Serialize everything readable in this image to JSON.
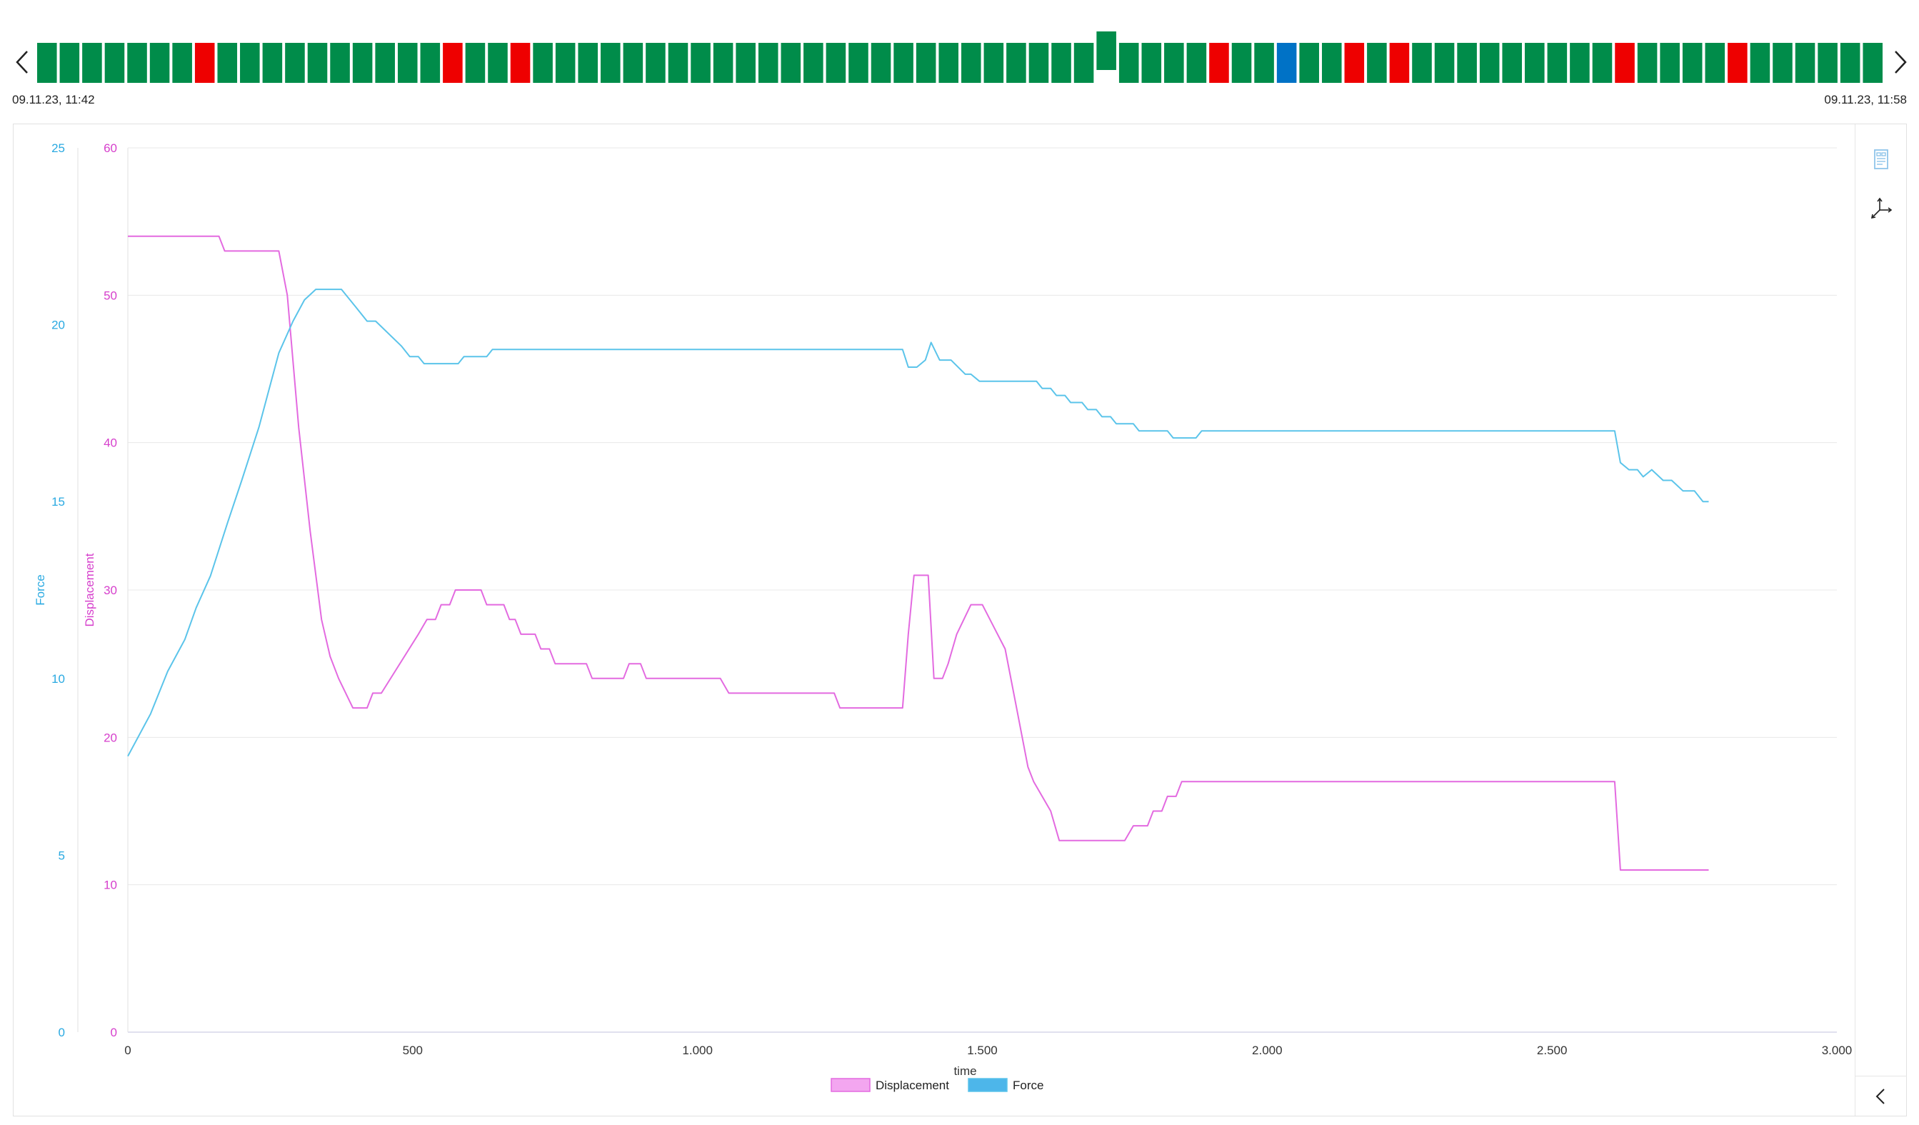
{
  "timeline": {
    "start_label": "09.11.23, 11:42",
    "end_label": "09.11.23, 11:58",
    "colors": {
      "ok": "#008c4a",
      "fail": "#ee0000",
      "info": "#0072c6"
    },
    "cycles": [
      "ok",
      "ok",
      "ok",
      "ok",
      "ok",
      "ok",
      "ok",
      "fail",
      "ok",
      "ok",
      "ok",
      "ok",
      "ok",
      "ok",
      "ok",
      "ok",
      "ok",
      "ok",
      "fail",
      "ok",
      "ok",
      "fail",
      "ok",
      "ok",
      "ok",
      "ok",
      "ok",
      "ok",
      "ok",
      "ok",
      "ok",
      "ok",
      "ok",
      "ok",
      "ok",
      "ok",
      "ok",
      "ok",
      "ok",
      "ok",
      "ok",
      "ok",
      "ok",
      "ok",
      "ok",
      "ok",
      "ok",
      "ok",
      "ok",
      "ok",
      "ok",
      "ok",
      "fail",
      "ok",
      "ok",
      "info",
      "ok",
      "ok",
      "fail",
      "ok",
      "fail",
      "ok",
      "ok",
      "ok",
      "ok",
      "ok",
      "ok",
      "ok",
      "ok",
      "ok",
      "fail",
      "ok",
      "ok",
      "ok",
      "ok",
      "fail",
      "ok",
      "ok",
      "ok",
      "ok",
      "ok",
      "ok"
    ],
    "selected_index": 47
  },
  "icons": {
    "prev": "chevron-left-icon",
    "next": "chevron-right-icon",
    "report": "document-icon",
    "axes": "axes-icon",
    "collapse": "chevron-left-icon"
  },
  "chart_data": {
    "type": "line",
    "xlabel": "time",
    "xlim": [
      0,
      3000
    ],
    "x_ticks": [
      0,
      500,
      1000,
      1500,
      2000,
      2500,
      3000
    ],
    "x_tick_labels": [
      "0",
      "500",
      "1.000",
      "1.500",
      "2.000",
      "2.500",
      "3.000"
    ],
    "axes": [
      {
        "id": "force",
        "label": "Force",
        "color": "#29a9e1",
        "lim": [
          0,
          25
        ],
        "ticks": [
          0,
          5,
          10,
          15,
          20,
          25
        ],
        "tick_labels": [
          "0",
          "5",
          "10",
          "15",
          "20",
          "25"
        ]
      },
      {
        "id": "displacement",
        "label": "Displacement",
        "color": "#d63fcc",
        "lim": [
          0,
          60
        ],
        "ticks": [
          0,
          10,
          20,
          30,
          40,
          50,
          60
        ],
        "tick_labels": [
          "0",
          "10",
          "20",
          "30",
          "40",
          "50",
          "60"
        ]
      }
    ],
    "grid": true,
    "legend": "bottom-center",
    "series": [
      {
        "name": "Displacement",
        "axis": "displacement",
        "color": "#e36ae0",
        "legend_fill": "#f3a6f0",
        "points": [
          [
            0,
            54.0
          ],
          [
            160,
            54.0
          ],
          [
            170,
            53.0
          ],
          [
            265,
            53.0
          ],
          [
            280,
            50.0
          ],
          [
            300,
            41.0
          ],
          [
            320,
            34.0
          ],
          [
            340,
            28.0
          ],
          [
            355,
            25.5
          ],
          [
            370,
            24.0
          ],
          [
            395,
            22.0
          ],
          [
            420,
            22.0
          ],
          [
            430,
            23.0
          ],
          [
            445,
            23.0
          ],
          [
            510,
            27.0
          ],
          [
            525,
            28.0
          ],
          [
            540,
            28.0
          ],
          [
            550,
            29.0
          ],
          [
            565,
            29.0
          ],
          [
            575,
            30.0
          ],
          [
            620,
            30.0
          ],
          [
            630,
            29.0
          ],
          [
            660,
            29.0
          ],
          [
            670,
            28.0
          ],
          [
            680,
            28.0
          ],
          [
            690,
            27.0
          ],
          [
            715,
            27.0
          ],
          [
            725,
            26.0
          ],
          [
            740,
            26.0
          ],
          [
            750,
            25.0
          ],
          [
            805,
            25.0
          ],
          [
            815,
            24.0
          ],
          [
            870,
            24.0
          ],
          [
            880,
            25.0
          ],
          [
            900,
            25.0
          ],
          [
            910,
            24.0
          ],
          [
            1040,
            24.0
          ],
          [
            1055,
            23.0
          ],
          [
            1240,
            23.0
          ],
          [
            1250,
            22.0
          ],
          [
            1360,
            22.0
          ],
          [
            1370,
            27.0
          ],
          [
            1380,
            31.0
          ],
          [
            1405,
            31.0
          ],
          [
            1415,
            24.0
          ],
          [
            1430,
            24.0
          ],
          [
            1440,
            25.0
          ],
          [
            1455,
            27.0
          ],
          [
            1480,
            29.0
          ],
          [
            1500,
            29.0
          ],
          [
            1540,
            26.0
          ],
          [
            1560,
            22.0
          ],
          [
            1580,
            18.0
          ],
          [
            1590,
            17.0
          ],
          [
            1620,
            15.0
          ],
          [
            1635,
            13.0
          ],
          [
            1750,
            13.0
          ],
          [
            1765,
            14.0
          ],
          [
            1790,
            14.0
          ],
          [
            1800,
            15.0
          ],
          [
            1815,
            15.0
          ],
          [
            1825,
            16.0
          ],
          [
            1840,
            16.0
          ],
          [
            1850,
            17.0
          ],
          [
            2610,
            17.0
          ],
          [
            2620,
            11.0
          ],
          [
            2775,
            11.0
          ]
        ]
      },
      {
        "name": "Force",
        "axis": "force",
        "color": "#5bc4ea",
        "legend_fill": "#4db6ea",
        "points": [
          [
            0,
            7.8
          ],
          [
            40,
            9.0
          ],
          [
            70,
            10.2
          ],
          [
            100,
            11.1
          ],
          [
            120,
            12.0
          ],
          [
            145,
            12.9
          ],
          [
            175,
            14.4
          ],
          [
            200,
            15.6
          ],
          [
            230,
            17.1
          ],
          [
            265,
            19.2
          ],
          [
            290,
            20.1
          ],
          [
            310,
            20.7
          ],
          [
            330,
            21.0
          ],
          [
            375,
            21.0
          ],
          [
            400,
            20.5
          ],
          [
            420,
            20.1
          ],
          [
            435,
            20.1
          ],
          [
            480,
            19.4
          ],
          [
            495,
            19.1
          ],
          [
            510,
            19.1
          ],
          [
            520,
            18.9
          ],
          [
            580,
            18.9
          ],
          [
            590,
            19.1
          ],
          [
            630,
            19.1
          ],
          [
            640,
            19.3
          ],
          [
            1360,
            19.3
          ],
          [
            1370,
            18.8
          ],
          [
            1385,
            18.8
          ],
          [
            1400,
            19.0
          ],
          [
            1410,
            19.5
          ],
          [
            1425,
            19.0
          ],
          [
            1445,
            19.0
          ],
          [
            1470,
            18.6
          ],
          [
            1480,
            18.6
          ],
          [
            1495,
            18.4
          ],
          [
            1595,
            18.4
          ],
          [
            1605,
            18.2
          ],
          [
            1620,
            18.2
          ],
          [
            1630,
            18.0
          ],
          [
            1645,
            18.0
          ],
          [
            1655,
            17.8
          ],
          [
            1675,
            17.8
          ],
          [
            1685,
            17.6
          ],
          [
            1700,
            17.6
          ],
          [
            1710,
            17.4
          ],
          [
            1725,
            17.4
          ],
          [
            1735,
            17.2
          ],
          [
            1765,
            17.2
          ],
          [
            1775,
            17.0
          ],
          [
            1825,
            17.0
          ],
          [
            1835,
            16.8
          ],
          [
            1875,
            16.8
          ],
          [
            1885,
            17.0
          ],
          [
            2610,
            17.0
          ],
          [
            2620,
            16.1
          ],
          [
            2635,
            15.9
          ],
          [
            2650,
            15.9
          ],
          [
            2660,
            15.7
          ],
          [
            2675,
            15.9
          ],
          [
            2695,
            15.6
          ],
          [
            2710,
            15.6
          ],
          [
            2730,
            15.3
          ],
          [
            2750,
            15.3
          ],
          [
            2765,
            15.0
          ],
          [
            2775,
            15.0
          ]
        ]
      }
    ]
  }
}
